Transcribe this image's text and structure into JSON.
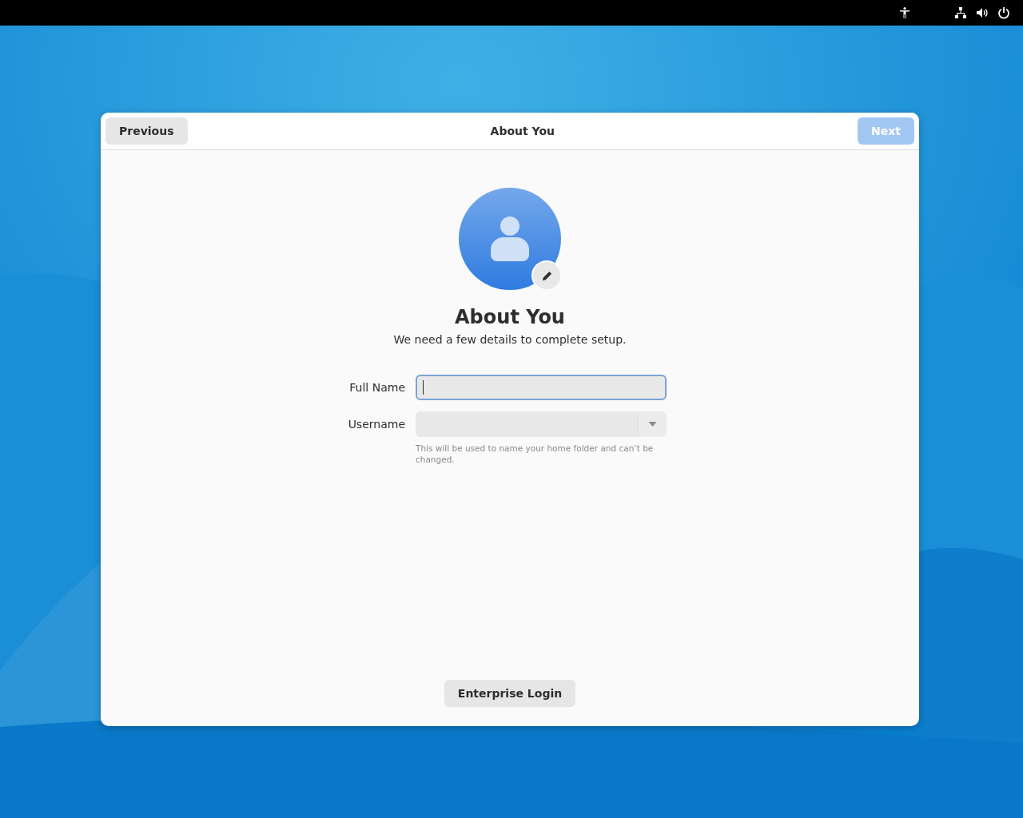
{
  "header": {
    "previous": {
      "label": "Previous",
      "disabled": false
    },
    "title": "About You",
    "next": {
      "label": "Next",
      "disabled": true
    }
  },
  "page": {
    "heading": "About You",
    "subtitle": "We need a few details to complete setup."
  },
  "fields": [
    {
      "kind": "entry",
      "label": "Full Name",
      "focused": true
    },
    {
      "kind": "combo",
      "label": "Username",
      "focused": false,
      "hint": "This will be used to name your home folder and can’t be changed."
    }
  ],
  "enterprise_button": {
    "label": "Enterprise Login"
  }
}
